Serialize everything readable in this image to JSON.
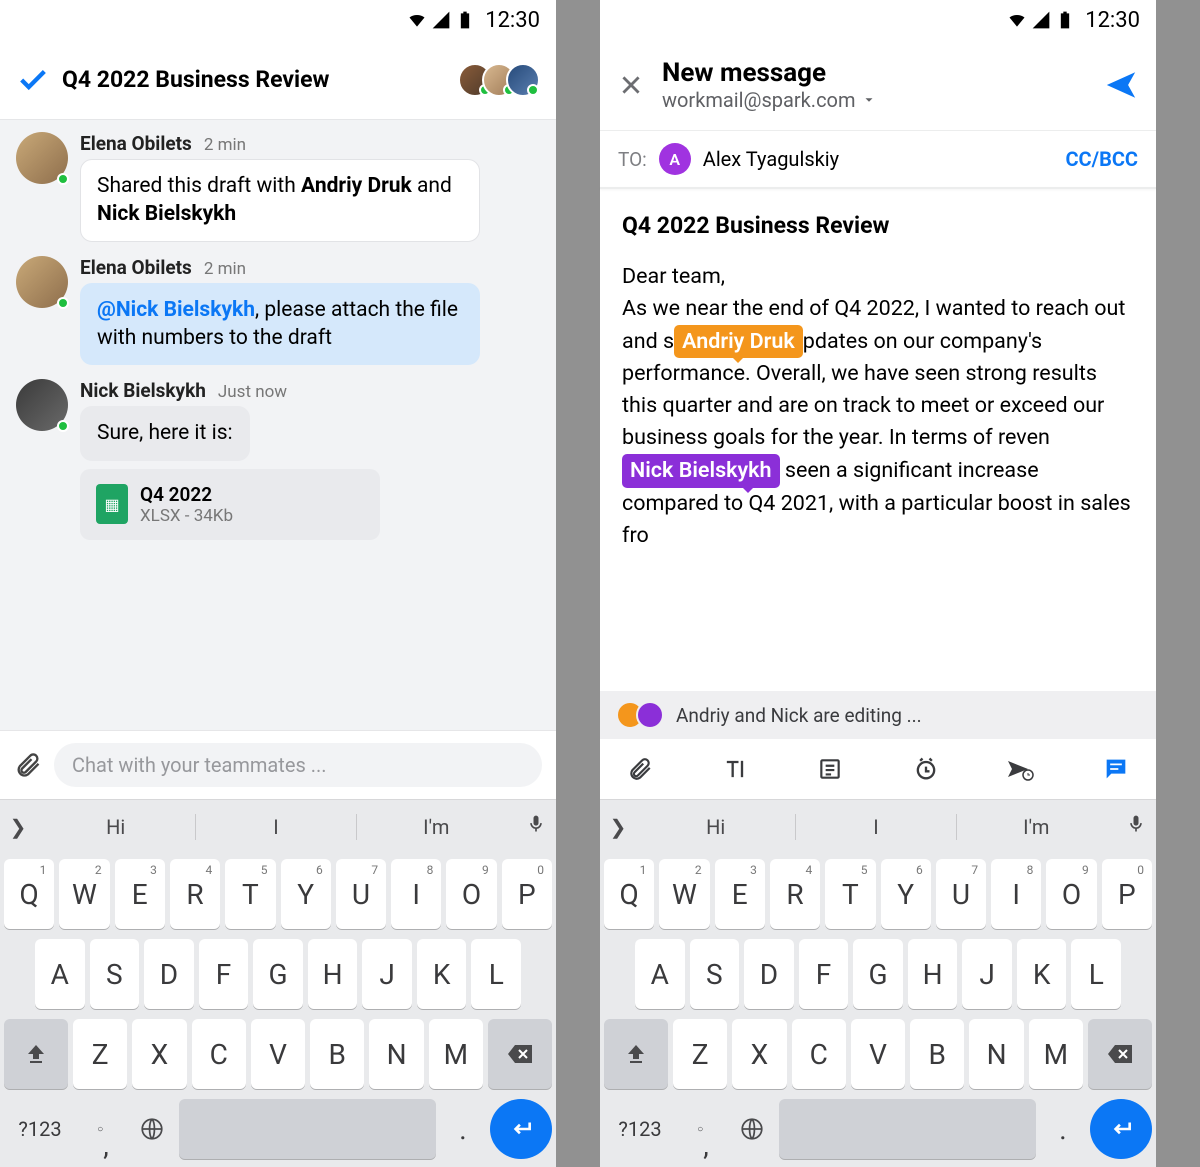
{
  "status": {
    "time": "12:30"
  },
  "left": {
    "title": "Q4 2022 Business Review",
    "messages": [
      {
        "sender": "Elena Obilets",
        "time": "2 min",
        "body_prefix": "Shared this draft with ",
        "bold1": "Andriy Druk",
        "mid": " and ",
        "bold2": "Nick Bielskykh"
      },
      {
        "sender": "Elena Obilets",
        "time": "2 min",
        "mention": "@Nick Bielskykh",
        "rest": ", please attach the file with numbers to the draft"
      },
      {
        "sender": "Nick Bielskykh",
        "time": "Just now",
        "body": "Sure, here it is:",
        "file": {
          "name": "Q4 2022",
          "meta": "XLSX - 34Kb"
        }
      }
    ],
    "input_placeholder": "Chat with your teammates ..."
  },
  "right": {
    "title": "New message",
    "from": "workmail@spark.com",
    "to_label": "TO:",
    "to_initial": "A",
    "to_name": "Alex Tyagulskiy",
    "ccbcc": "CC/BCC",
    "subject": "Q4 2022 Business Review",
    "body": {
      "p1": "Dear team,",
      "p2a": "As we near the end of Q4 2022, I wanted to reach out and s",
      "tag1": "Andriy Druk",
      "p2b": "pdates on our company's performance. Overall, we have seen strong results this quarter and are on track to meet or exceed our business goals for the year. In terms of reven",
      "tag2": "Nick Bielskykh",
      "p2c": " seen a significant increase compared to Q4 2021, with a particular boost in sales fro"
    },
    "editing": "Andriy and Nick are editing ..."
  },
  "sugg": {
    "a": "Hi",
    "b": "I",
    "c": "I'm"
  },
  "keys": {
    "r1": [
      "Q",
      "W",
      "E",
      "R",
      "T",
      "Y",
      "U",
      "I",
      "O",
      "P"
    ],
    "r2": [
      "A",
      "S",
      "D",
      "F",
      "G",
      "H",
      "J",
      "K",
      "L"
    ],
    "r3": [
      "Z",
      "X",
      "C",
      "V",
      "B",
      "N",
      "M"
    ],
    "sym": "?123"
  }
}
